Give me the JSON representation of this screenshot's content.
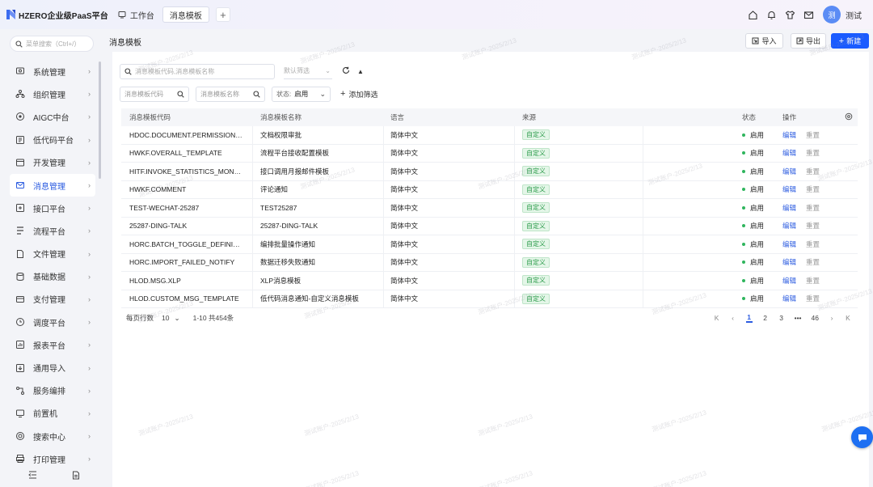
{
  "app": {
    "title": "HZERO企业级PaaS平台",
    "brand_color": "#2c5ce0"
  },
  "tabs": {
    "workbench": "工作台",
    "active": "消息模板",
    "add": "+"
  },
  "user": {
    "avatar_text": "测",
    "name": "测试"
  },
  "sidebar": {
    "search_placeholder": "菜单搜索（Ctrl+/）",
    "items": [
      {
        "label": "系统管理",
        "icon": "system-icon"
      },
      {
        "label": "组织管理",
        "icon": "org-icon"
      },
      {
        "label": "AIGC中台",
        "icon": "ai-icon"
      },
      {
        "label": "低代码平台",
        "icon": "lowcode-icon"
      },
      {
        "label": "开发管理",
        "icon": "dev-icon"
      },
      {
        "label": "消息管理",
        "icon": "message-icon",
        "active": true
      },
      {
        "label": "接口平台",
        "icon": "api-icon"
      },
      {
        "label": "流程平台",
        "icon": "flow-icon"
      },
      {
        "label": "文件管理",
        "icon": "file-icon"
      },
      {
        "label": "基础数据",
        "icon": "data-icon"
      },
      {
        "label": "支付管理",
        "icon": "pay-icon"
      },
      {
        "label": "调度平台",
        "icon": "schedule-icon"
      },
      {
        "label": "报表平台",
        "icon": "report-icon"
      },
      {
        "label": "通用导入",
        "icon": "import-icon"
      },
      {
        "label": "服务编排",
        "icon": "orchestrate-icon"
      },
      {
        "label": "前置机",
        "icon": "frontend-icon"
      },
      {
        "label": "搜索中心",
        "icon": "search-center-icon"
      },
      {
        "label": "打印管理",
        "icon": "print-icon"
      }
    ]
  },
  "page": {
    "title": "消息模板",
    "import_label": "导入",
    "export_label": "导出",
    "new_label": "新建"
  },
  "filters": {
    "search_placeholder": "消息模板代码,消息模板名称",
    "preset_placeholder": "默认筛选",
    "code_placeholder": "消息模板代码",
    "name_placeholder": "消息模板名称",
    "status_label": "状态:",
    "status_value": "启用",
    "add_filter": "添加筛选"
  },
  "table": {
    "headers": {
      "code": "消息模板代码",
      "name": "消息模板名称",
      "lang": "语言",
      "source": "来源",
      "status": "状态",
      "ops": "操作"
    },
    "rows": [
      {
        "code": "HDOC.DOCUMENT.PERMISSION_...",
        "name": "文档权限审批",
        "lang": "简体中文",
        "source": "自定义",
        "status": "启用",
        "edit": "编辑",
        "reset": "重置"
      },
      {
        "code": "HWKF.OVERALL_TEMPLATE",
        "name": "流程平台接收配置模板",
        "lang": "简体中文",
        "source": "自定义",
        "status": "启用",
        "edit": "编辑",
        "reset": "重置"
      },
      {
        "code": "HITF.INVOKE_STATISTICS_MONT...",
        "name": "接口调用月报邮件模板",
        "lang": "简体中文",
        "source": "自定义",
        "status": "启用",
        "edit": "编辑",
        "reset": "重置"
      },
      {
        "code": "HWKF.COMMENT",
        "name": "评论通知",
        "lang": "简体中文",
        "source": "自定义",
        "status": "启用",
        "edit": "编辑",
        "reset": "重置"
      },
      {
        "code": "TEST-WECHAT-25287",
        "name": "TEST25287",
        "lang": "简体中文",
        "source": "自定义",
        "status": "启用",
        "edit": "编辑",
        "reset": "重置"
      },
      {
        "code": "25287-DING-TALK",
        "name": "25287-DING-TALK",
        "lang": "简体中文",
        "source": "自定义",
        "status": "启用",
        "edit": "编辑",
        "reset": "重置"
      },
      {
        "code": "HORC.BATCH_TOGGLE_DEFINITI...",
        "name": "编排批量操作通知",
        "lang": "简体中文",
        "source": "自定义",
        "status": "启用",
        "edit": "编辑",
        "reset": "重置"
      },
      {
        "code": "HORC.IMPORT_FAILED_NOTIFY",
        "name": "数据迁移失败通知",
        "lang": "简体中文",
        "source": "自定义",
        "status": "启用",
        "edit": "编辑",
        "reset": "重置"
      },
      {
        "code": "HLOD.MSG.XLP",
        "name": "XLP消息模板",
        "lang": "简体中文",
        "source": "自定义",
        "status": "启用",
        "edit": "编辑",
        "reset": "重置"
      },
      {
        "code": "HLOD.CUSTOM_MSG_TEMPLATE",
        "name": "低代码消息通知-自定义消息模板",
        "lang": "简体中文",
        "source": "自定义",
        "status": "启用",
        "edit": "编辑",
        "reset": "重置"
      }
    ]
  },
  "pagination": {
    "page_size_label": "每页行数",
    "page_size": "10",
    "range": "1-10  共454条",
    "pages": [
      "1",
      "2",
      "3"
    ],
    "ellipsis": "•••",
    "last": "46",
    "current": "1"
  },
  "watermark": "测试账户-2025/2/13"
}
